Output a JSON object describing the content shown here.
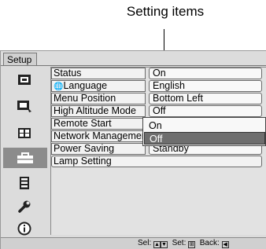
{
  "callout": {
    "title": "Setting items"
  },
  "window": {
    "tab_label": "Setup"
  },
  "sidebar": {
    "items": [
      {
        "icon": "picture-icon",
        "selected": false
      },
      {
        "icon": "picture-adjust-icon",
        "selected": false
      },
      {
        "icon": "screen-icon",
        "selected": false
      },
      {
        "icon": "setup-toolbox-icon",
        "selected": true
      },
      {
        "icon": "menu-list-icon",
        "selected": false
      },
      {
        "icon": "wrench-icon",
        "selected": false
      },
      {
        "icon": "info-icon",
        "selected": false
      }
    ]
  },
  "settings": [
    {
      "label": "Status",
      "value": "On"
    },
    {
      "label": "Language",
      "value": "English"
    },
    {
      "label": "Menu Position",
      "value": "Bottom Left"
    },
    {
      "label": "High Altitude Mode",
      "value": "Off"
    },
    {
      "label": "Remote Start",
      "value": ""
    },
    {
      "label": "Network Management",
      "value": ""
    },
    {
      "label": "Power Saving",
      "value": "Standby"
    },
    {
      "label": "Lamp Setting",
      "value": ""
    }
  ],
  "dropdown": {
    "options": [
      "On",
      "Off"
    ],
    "selected": "Off"
  },
  "statusbar": {
    "sel_label": "Sel:",
    "set_label": "Set:",
    "back_label": "Back:"
  }
}
